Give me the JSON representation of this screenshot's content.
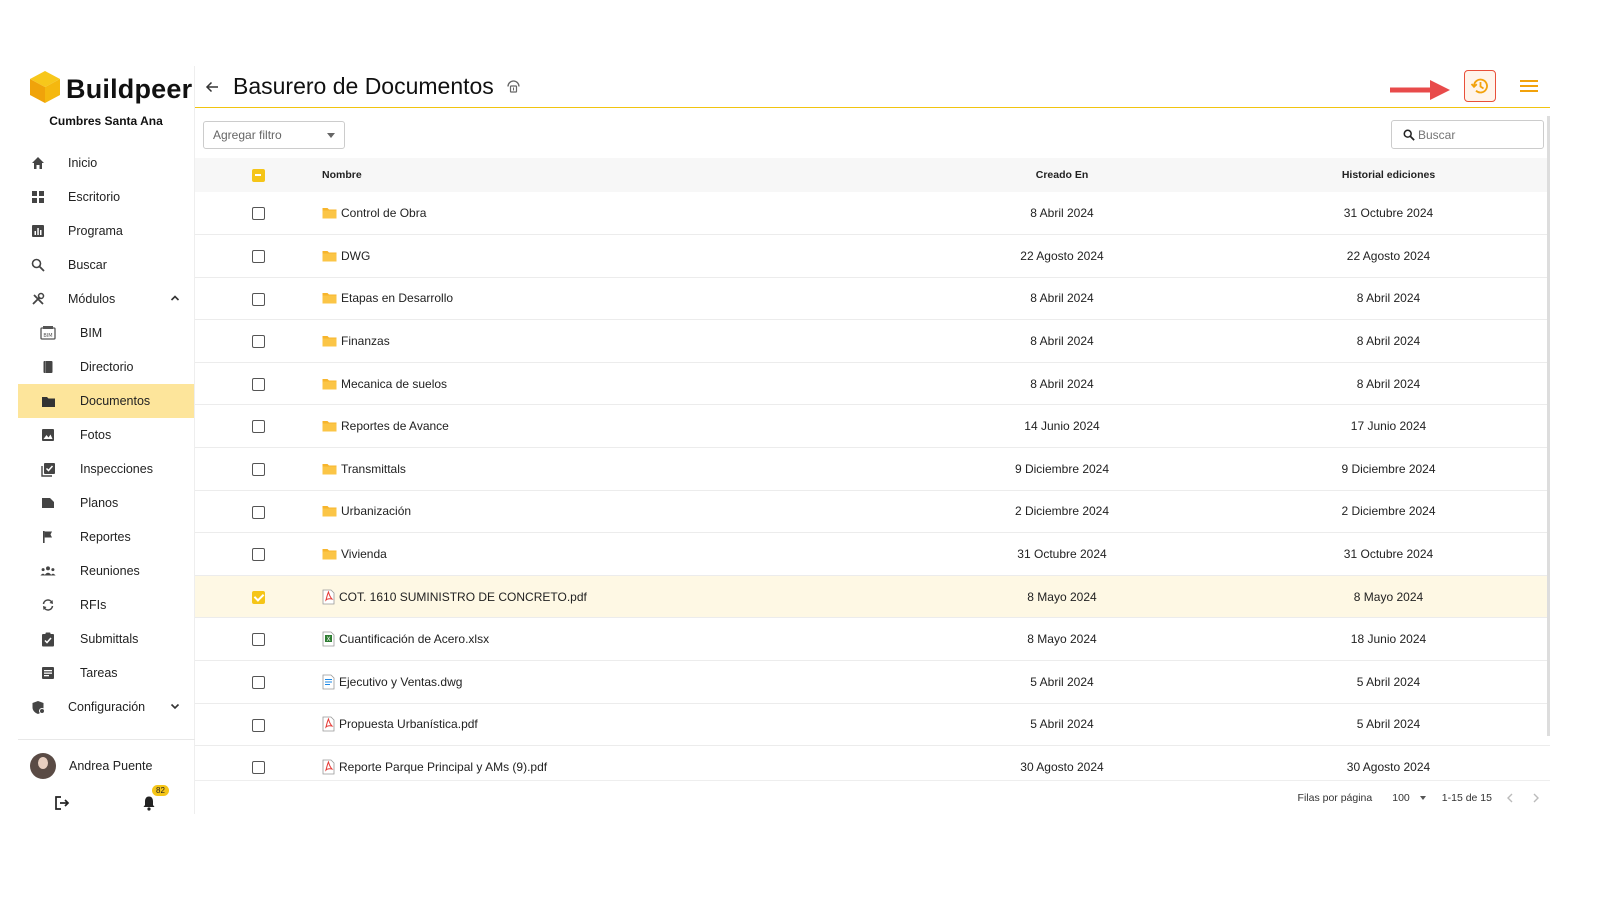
{
  "brand": {
    "name": "Buildpeer",
    "project": "Cumbres Santa Ana"
  },
  "sidebar": {
    "items": [
      {
        "label": "Inicio",
        "icon": "home-icon"
      },
      {
        "label": "Escritorio",
        "icon": "dashboard-icon"
      },
      {
        "label": "Programa",
        "icon": "chart-icon"
      },
      {
        "label": "Buscar",
        "icon": "search-icon"
      },
      {
        "label": "Módulos",
        "icon": "tools-icon"
      },
      {
        "label": "BIM",
        "icon": "bim-icon"
      },
      {
        "label": "Directorio",
        "icon": "book-icon"
      },
      {
        "label": "Documentos",
        "icon": "folder-icon"
      },
      {
        "label": "Fotos",
        "icon": "image-icon"
      },
      {
        "label": "Inspecciones",
        "icon": "checklist-icon"
      },
      {
        "label": "Planos",
        "icon": "plans-icon"
      },
      {
        "label": "Reportes",
        "icon": "flag-icon"
      },
      {
        "label": "Reuniones",
        "icon": "people-icon"
      },
      {
        "label": "RFIs",
        "icon": "sync-icon"
      },
      {
        "label": "Submittals",
        "icon": "clipboard-check-icon"
      },
      {
        "label": "Tareas",
        "icon": "tasks-icon"
      },
      {
        "label": "Configuración",
        "icon": "settings-icon"
      }
    ],
    "user": {
      "name": "Andrea Puente",
      "notifications": "82"
    }
  },
  "header": {
    "title": "Basurero de Documentos"
  },
  "toolbar": {
    "filter_label": "Agregar filtro",
    "search_placeholder": "Buscar"
  },
  "table": {
    "columns": {
      "name": "Nombre",
      "created": "Creado En",
      "history": "Historial ediciones"
    },
    "rows": [
      {
        "name": "Control de Obra",
        "type": "folder",
        "created": "8 Abril 2024",
        "history": "31 Octubre 2024",
        "checked": false
      },
      {
        "name": "DWG",
        "type": "folder",
        "created": "22 Agosto 2024",
        "history": "22 Agosto 2024",
        "checked": false
      },
      {
        "name": "Etapas en Desarrollo",
        "type": "folder",
        "created": "8 Abril 2024",
        "history": "8 Abril 2024",
        "checked": false
      },
      {
        "name": "Finanzas",
        "type": "folder",
        "created": "8 Abril 2024",
        "history": "8 Abril 2024",
        "checked": false
      },
      {
        "name": "Mecanica de suelos",
        "type": "folder",
        "created": "8 Abril 2024",
        "history": "8 Abril 2024",
        "checked": false
      },
      {
        "name": "Reportes de Avance",
        "type": "folder",
        "created": "14 Junio 2024",
        "history": "17 Junio 2024",
        "checked": false
      },
      {
        "name": "Transmittals",
        "type": "folder",
        "created": "9 Diciembre 2024",
        "history": "9 Diciembre 2024",
        "checked": false
      },
      {
        "name": "Urbanización",
        "type": "folder",
        "created": "2 Diciembre 2024",
        "history": "2 Diciembre 2024",
        "checked": false
      },
      {
        "name": "Vivienda",
        "type": "folder",
        "created": "31 Octubre 2024",
        "history": "31 Octubre 2024",
        "checked": false
      },
      {
        "name": "COT. 1610 SUMINISTRO DE CONCRETO.pdf",
        "type": "pdf",
        "created": "8 Mayo 2024",
        "history": "8 Mayo 2024",
        "checked": true
      },
      {
        "name": "Cuantificación de Acero.xlsx",
        "type": "xlsx",
        "created": "8 Mayo 2024",
        "history": "18 Junio 2024",
        "checked": false
      },
      {
        "name": "Ejecutivo y Ventas.dwg",
        "type": "dwg",
        "created": "5 Abril 2024",
        "history": "5 Abril 2024",
        "checked": false
      },
      {
        "name": "Propuesta Urbanística.pdf",
        "type": "pdf",
        "created": "5 Abril 2024",
        "history": "5 Abril 2024",
        "checked": false
      },
      {
        "name": "Reporte Parque Principal y AMs (9).pdf",
        "type": "pdf",
        "created": "30 Agosto 2024",
        "history": "30 Agosto 2024",
        "checked": false
      }
    ]
  },
  "pagination": {
    "rows_label": "Filas por página",
    "rows_value": "100",
    "range": "1-15 de 15"
  },
  "colors": {
    "accent": "#f5c518",
    "active_bg": "#fde59b",
    "highlight": "#e8503a"
  }
}
